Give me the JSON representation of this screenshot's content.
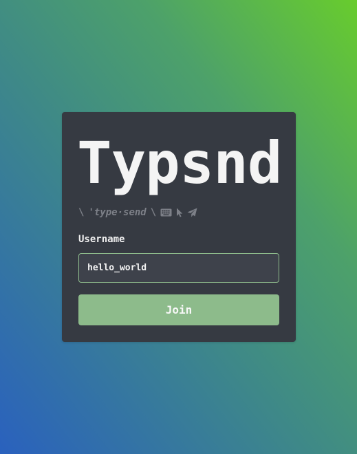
{
  "app": {
    "title": "Typsnd",
    "pronunciation": {
      "open_slash": "\\",
      "text": "'type·send",
      "close_slash": "\\",
      "icons": [
        "keyboard-icon",
        "cursor-icon",
        "send-icon"
      ]
    }
  },
  "form": {
    "username_label": "Username",
    "username_value": "hello_world",
    "join_label": "Join"
  },
  "colors": {
    "card": "#363a42",
    "accent": "#8dbb8b",
    "gradient_start": "#2a61be",
    "gradient_end": "#68cc2d"
  }
}
